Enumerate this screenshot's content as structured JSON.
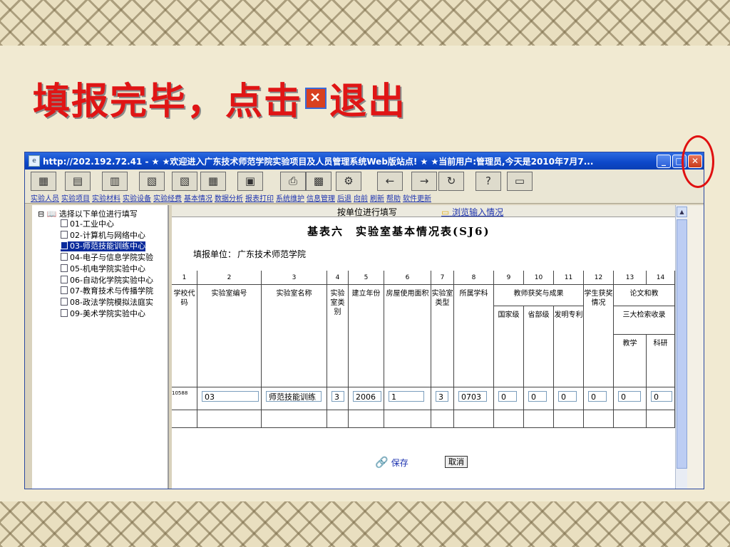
{
  "slide": {
    "title_before": "填报完毕，点击",
    "title_icon": "close-icon",
    "title_after": "退出"
  },
  "window": {
    "title": "http://202.192.72.41 - ★ ★欢迎进入广东技术师范学院实验项目及人员管理系统Web版站点! ★ ★当前用户:管理员,今天是2010年7月7...",
    "buttons": {
      "minimize": "_",
      "maximize": "□",
      "close": "✕"
    }
  },
  "toolbar": {
    "labels": [
      "实验人员",
      "实验项目",
      "实验材料",
      "实验设备",
      "实验经费",
      "基本情况",
      "数据分析",
      "报表打印",
      "系统维护",
      "信息管理",
      "后退",
      "向前",
      "刷新",
      "帮助",
      "软件更新"
    ],
    "icons": [
      "people-icon",
      "project-icon",
      "material-icon",
      "device-icon",
      "fund-icon",
      "info-icon",
      "analysis-icon",
      "print-icon",
      "maintain-icon",
      "manage-icon",
      "back-arrow-icon",
      "forward-arrow-icon",
      "refresh-icon",
      "help-icon",
      "update-icon"
    ],
    "glyphs": [
      "▦",
      "▤",
      "▥",
      "▧",
      "▧",
      "▦",
      "▣",
      "⎙",
      "▩",
      "⚙",
      "←",
      "→",
      "↻",
      "?",
      "▭"
    ]
  },
  "tree": {
    "root": "选择以下单位进行填写",
    "items": [
      "01-工业中心",
      "02-计算机与网络中心",
      "03-师范技能训练中心",
      "04-电子与信息学院实验",
      "05-机电学院实验中心",
      "06-自动化学院实验中心",
      "07-教育技术与传播学院",
      "08-政法学院模拟法庭实",
      "09-美术学院实验中心"
    ],
    "selected_index": 2
  },
  "tabs": {
    "active": "按单位进行填写",
    "link": "浏览输入情况"
  },
  "form": {
    "title": "基表六　实验室基本情况表(SJ6)",
    "unit_label": "填报单位：",
    "unit_value": "广东技术师范学院",
    "col_numbers": [
      "1",
      "2",
      "3",
      "4",
      "5",
      "6",
      "7",
      "8",
      "9",
      "10",
      "11",
      "12",
      "13",
      "14"
    ],
    "headers": {
      "school_code": "学校代码",
      "lab_no": "实验室编号",
      "lab_name": "实验室名称",
      "lab_category": "实验室类别",
      "year": "建立年份",
      "area": "房屋使用面积",
      "lab_type": "实验室类型",
      "subject": "所属学科",
      "award_group": "教师获奖与成果",
      "national": "国家级",
      "provincial": "省部级",
      "patent": "发明专利",
      "student_award": "学生获奖情况",
      "papers": "论文和教",
      "three_index": "三大检索收录",
      "teaching": "教学",
      "research": "科研"
    },
    "row": {
      "school_code": "10588",
      "lab_no": "03",
      "lab_name": "师范技能训练",
      "lab_category": "3",
      "year": "2006",
      "area": "1",
      "lab_type": "3",
      "subject": "0703",
      "national": "0",
      "provincial": "0",
      "patent": "0",
      "student_award": "0",
      "three_index_teaching": "0",
      "three_index_research": "0"
    },
    "save_label": "保存",
    "cancel_label": "取消"
  }
}
